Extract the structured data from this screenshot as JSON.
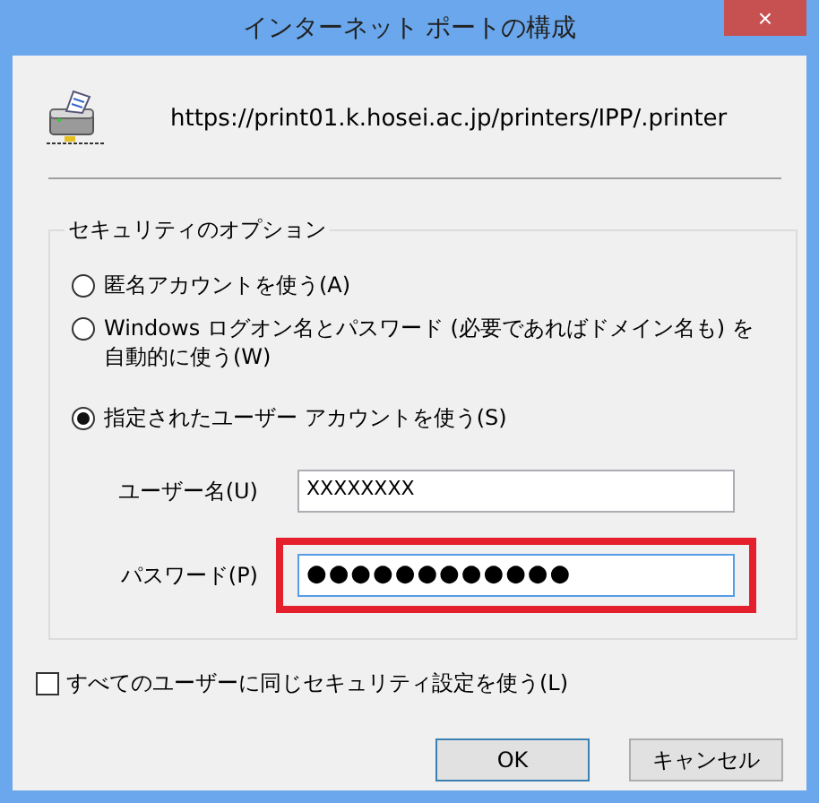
{
  "window": {
    "title": "インターネット ポートの構成",
    "close": "×"
  },
  "url": "https://print01.k.hosei.ac.jp/printers/IPP/.printer",
  "group": {
    "title": "セキュリティのオプション",
    "options": [
      {
        "label": "匿名アカウントを使う(A)",
        "selected": false
      },
      {
        "label": "Windows ログオン名とパスワード (必要であればドメイン名も) を自動的に使う(W)",
        "selected": false
      },
      {
        "label": "指定されたユーザー アカウントを使う(S)",
        "selected": true
      }
    ],
    "fields": [
      {
        "label": "ユーザー名(U)",
        "value": "XXXXXXXX",
        "highlighted": false
      },
      {
        "label": "パスワード(P)",
        "value": "●●●●●●●●●●●●",
        "highlighted": true
      }
    ]
  },
  "same_for_all": {
    "label": "すべてのユーザーに同じセキュリティ設定を使う(L)",
    "checked": false
  },
  "buttons": [
    {
      "label": "OK",
      "default": true
    },
    {
      "label": "キャンセル",
      "default": false
    }
  ]
}
